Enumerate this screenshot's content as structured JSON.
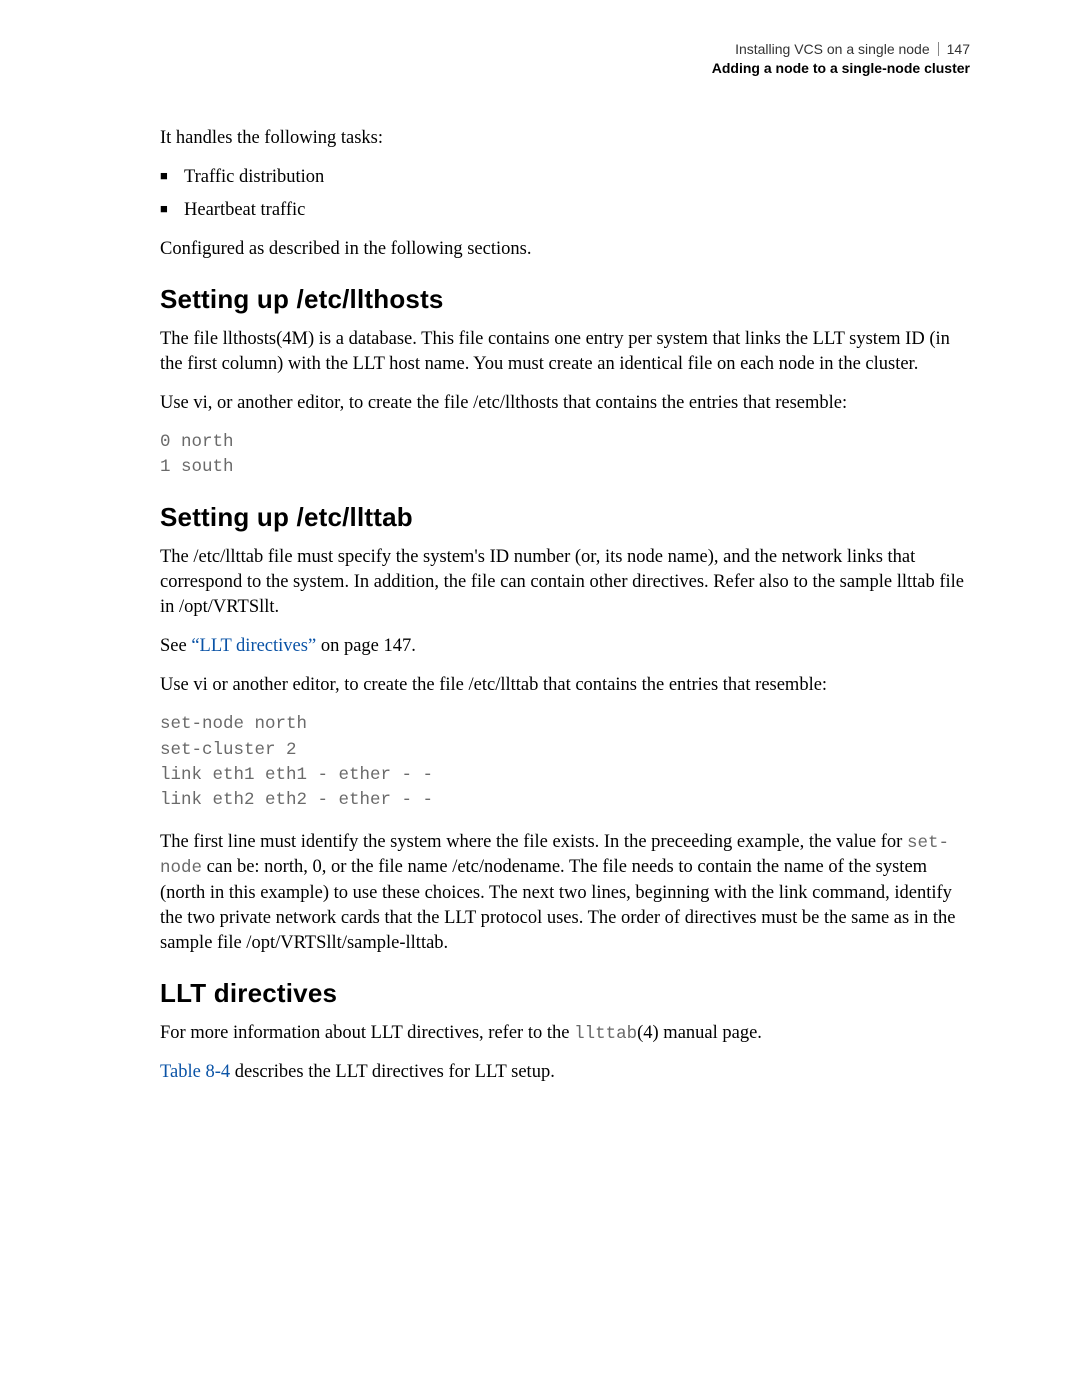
{
  "header": {
    "top_line": "Installing VCS on a single node",
    "page_number": "147",
    "sub_line": "Adding a node to a single-node cluster"
  },
  "intro": {
    "p1": "It handles the following tasks:",
    "bullets": [
      "Traffic distribution",
      "Heartbeat traffic"
    ],
    "p2": "Configured as described in the following sections."
  },
  "section_llthosts": {
    "heading": "Setting up /etc/llthosts",
    "p1": "The file llthosts(4M) is a database. This file contains one entry per system that links the LLT system ID (in the first column) with the LLT host name. You must create an identical file on each node in the cluster.",
    "p2": "Use vi, or another editor, to create the file /etc/llthosts that contains the entries that resemble:",
    "code": "0 north\n1 south"
  },
  "section_llttab": {
    "heading": "Setting up /etc/llttab",
    "p1": "The /etc/llttab file must specify the system's ID number (or, its node name), and the network links that correspond to the system. In addition, the file can contain other directives. Refer also to the sample llttab file in /opt/VRTSllt.",
    "see_prefix": "See ",
    "see_link": "“LLT directives”",
    "see_suffix": " on page 147.",
    "p2": "Use vi or another editor, to create the file /etc/llttab that contains the entries that resemble:",
    "code": "set-node north\nset-cluster 2\nlink eth1 eth1 - ether - -\nlink eth2 eth2 - ether - -",
    "p3_prefix": "The first line must identify the system where the file exists. In the preceeding example, the value for ",
    "p3_code": "set-node",
    "p3_suffix": " can be: north, 0, or the file name /etc/nodename. The file needs to contain the name of the system (north in this example) to use these choices. The next two lines, beginning with the link command, identify the two private network cards that the LLT protocol uses. The order of directives must be the same as in the sample file /opt/VRTSllt/sample-llttab."
  },
  "section_directives": {
    "heading": "LLT directives",
    "p1_prefix": "For more information about LLT directives, refer to the ",
    "p1_code": "llttab",
    "p1_suffix": "(4) manual page.",
    "p2_link": "Table 8-4",
    "p2_suffix": " describes the LLT directives for LLT setup."
  }
}
